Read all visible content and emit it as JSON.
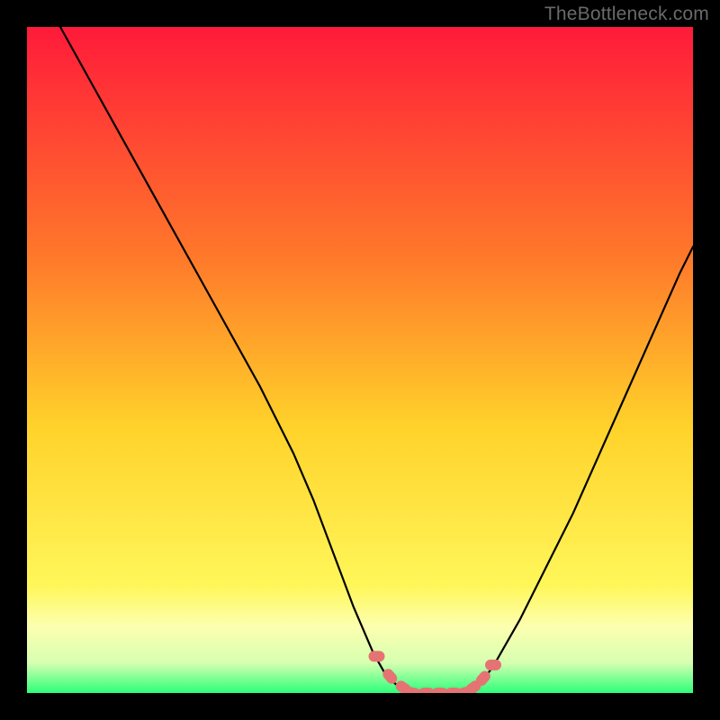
{
  "watermark": "TheBottleneck.com",
  "colors": {
    "bg": "#000000",
    "gradient_top": "#ff1a3a",
    "gradient_mid1": "#ff7a2a",
    "gradient_mid2": "#ffd22a",
    "gradient_mid3": "#fff75a",
    "gradient_bottom": "#2cff7a",
    "curve": "#000000",
    "marker": "#e57373"
  },
  "chart_data": {
    "type": "line",
    "title": "",
    "xlabel": "",
    "ylabel": "",
    "xlim": [
      0,
      100
    ],
    "ylim": [
      0,
      100
    ],
    "series": [
      {
        "name": "left-branch",
        "x": [
          5,
          10,
          15,
          20,
          25,
          30,
          35,
          40,
          43,
          46,
          49,
          52,
          54,
          56,
          57
        ],
        "y": [
          100,
          91,
          82,
          73,
          64,
          55,
          46,
          36,
          29,
          21,
          13,
          6,
          2.5,
          0.8,
          0
        ]
      },
      {
        "name": "valley-floor",
        "x": [
          57,
          59,
          61,
          63,
          65,
          67
        ],
        "y": [
          0,
          0,
          0,
          0,
          0,
          0
        ]
      },
      {
        "name": "right-branch",
        "x": [
          67,
          70,
          74,
          78,
          82,
          86,
          90,
          94,
          98,
          100
        ],
        "y": [
          0,
          4,
          11,
          19,
          27,
          36,
          45,
          54,
          63,
          67
        ]
      }
    ],
    "markers": {
      "name": "bottleneck-points",
      "x": [
        52.5,
        54.5,
        56.5,
        58,
        60,
        62,
        64,
        65.5,
        67,
        68.5,
        70
      ],
      "y": [
        5.5,
        2.5,
        0.8,
        0,
        0,
        0,
        0,
        0,
        0.8,
        2.2,
        4.2
      ]
    },
    "gradient_stops": [
      {
        "offset": 0.0,
        "color": "#ff1a3a"
      },
      {
        "offset": 0.35,
        "color": "#ff7a2a"
      },
      {
        "offset": 0.6,
        "color": "#ffd22a"
      },
      {
        "offset": 0.84,
        "color": "#fff75a"
      },
      {
        "offset": 0.9,
        "color": "#fdffb0"
      },
      {
        "offset": 0.955,
        "color": "#d6ffb0"
      },
      {
        "offset": 1.0,
        "color": "#2cff7a"
      }
    ]
  }
}
